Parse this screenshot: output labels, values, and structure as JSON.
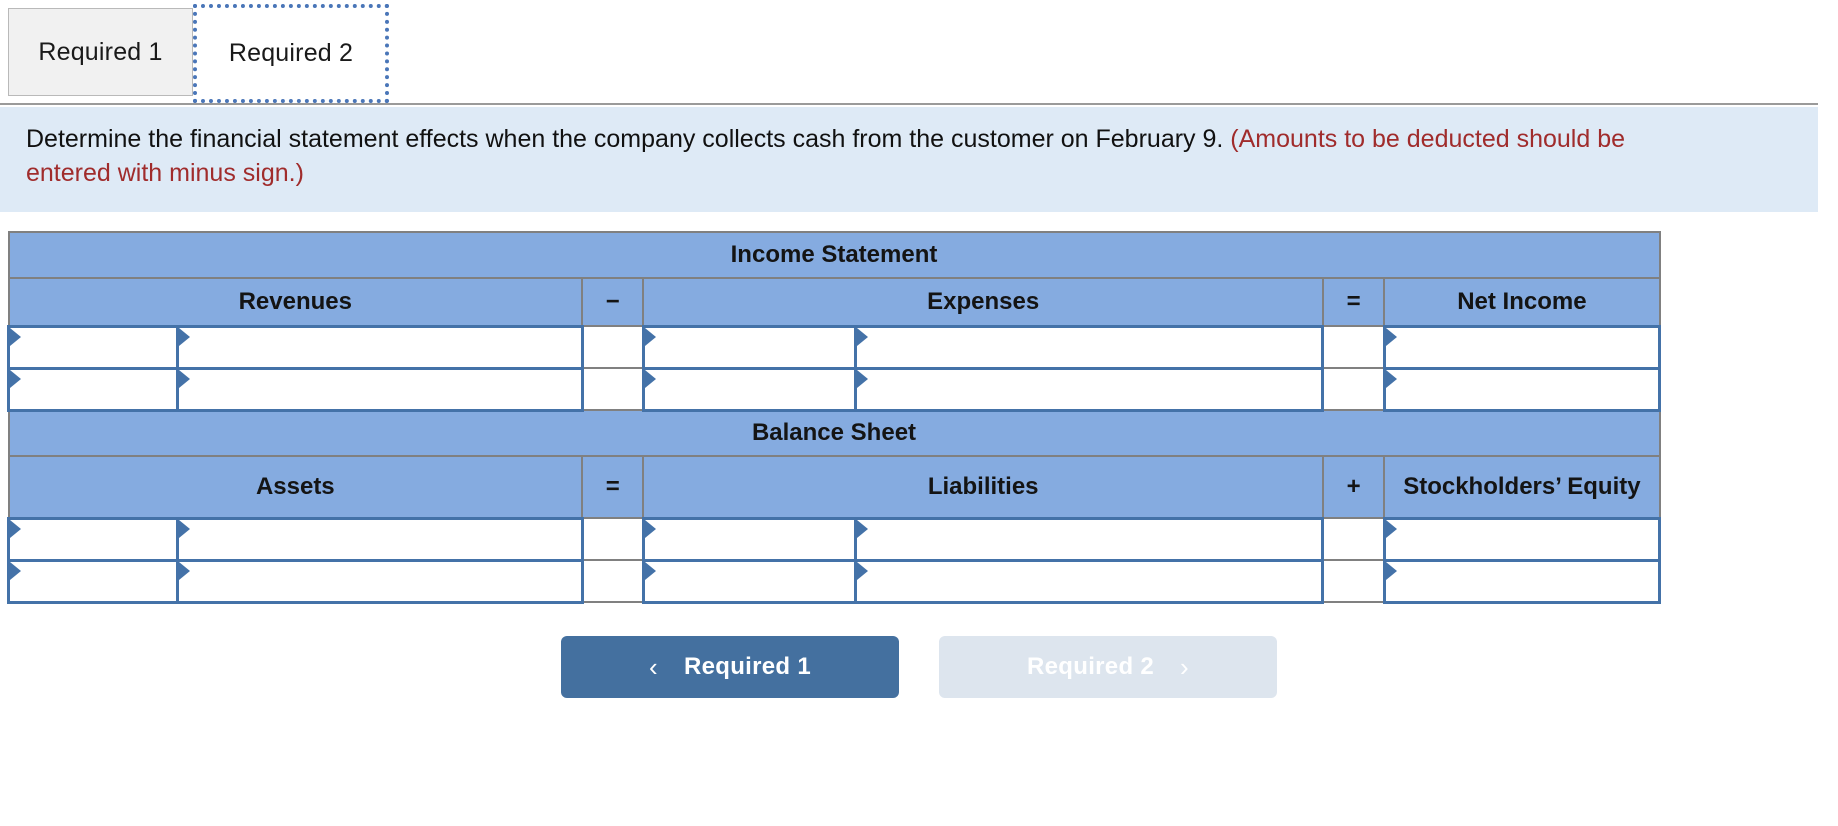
{
  "tabs": [
    {
      "label": "Required 1",
      "active": false
    },
    {
      "label": "Required 2",
      "active": true
    }
  ],
  "instructions": {
    "main": "Determine the financial statement effects when the company collects cash from the customer on February 9.",
    "note_line1": "(Amounts to be deducted should be",
    "note_line2": "entered with minus sign.)",
    "note_color": "#a02c2c",
    "background_color": "#deeaf6"
  },
  "worksheet": {
    "header_color": "#85abe0",
    "input_border_color": "#4472a8",
    "sections": [
      {
        "title": "Income Statement",
        "columns": [
          {
            "label": "Revenues",
            "type": "value",
            "cells": 2
          },
          {
            "label": "−",
            "type": "operator"
          },
          {
            "label": "Expenses",
            "type": "value",
            "cells": 2
          },
          {
            "label": "=",
            "type": "operator"
          },
          {
            "label": "Net Income",
            "type": "value",
            "cells": 1
          }
        ],
        "rows": 2
      },
      {
        "title": "Balance Sheet",
        "columns": [
          {
            "label": "Assets",
            "type": "value",
            "cells": 2
          },
          {
            "label": "=",
            "type": "operator"
          },
          {
            "label": "Liabilities",
            "type": "value",
            "cells": 2
          },
          {
            "label": "+",
            "type": "operator"
          },
          {
            "label": "Stockholders’ Equity",
            "type": "value",
            "cells": 1
          }
        ],
        "rows": 2
      }
    ]
  },
  "navigation": {
    "prev": {
      "label": "Required 1",
      "icon": "chevron-left-icon",
      "glyph": "‹",
      "enabled": true
    },
    "next": {
      "label": "Required 2",
      "icon": "chevron-right-icon",
      "glyph": "›",
      "enabled": false
    }
  }
}
